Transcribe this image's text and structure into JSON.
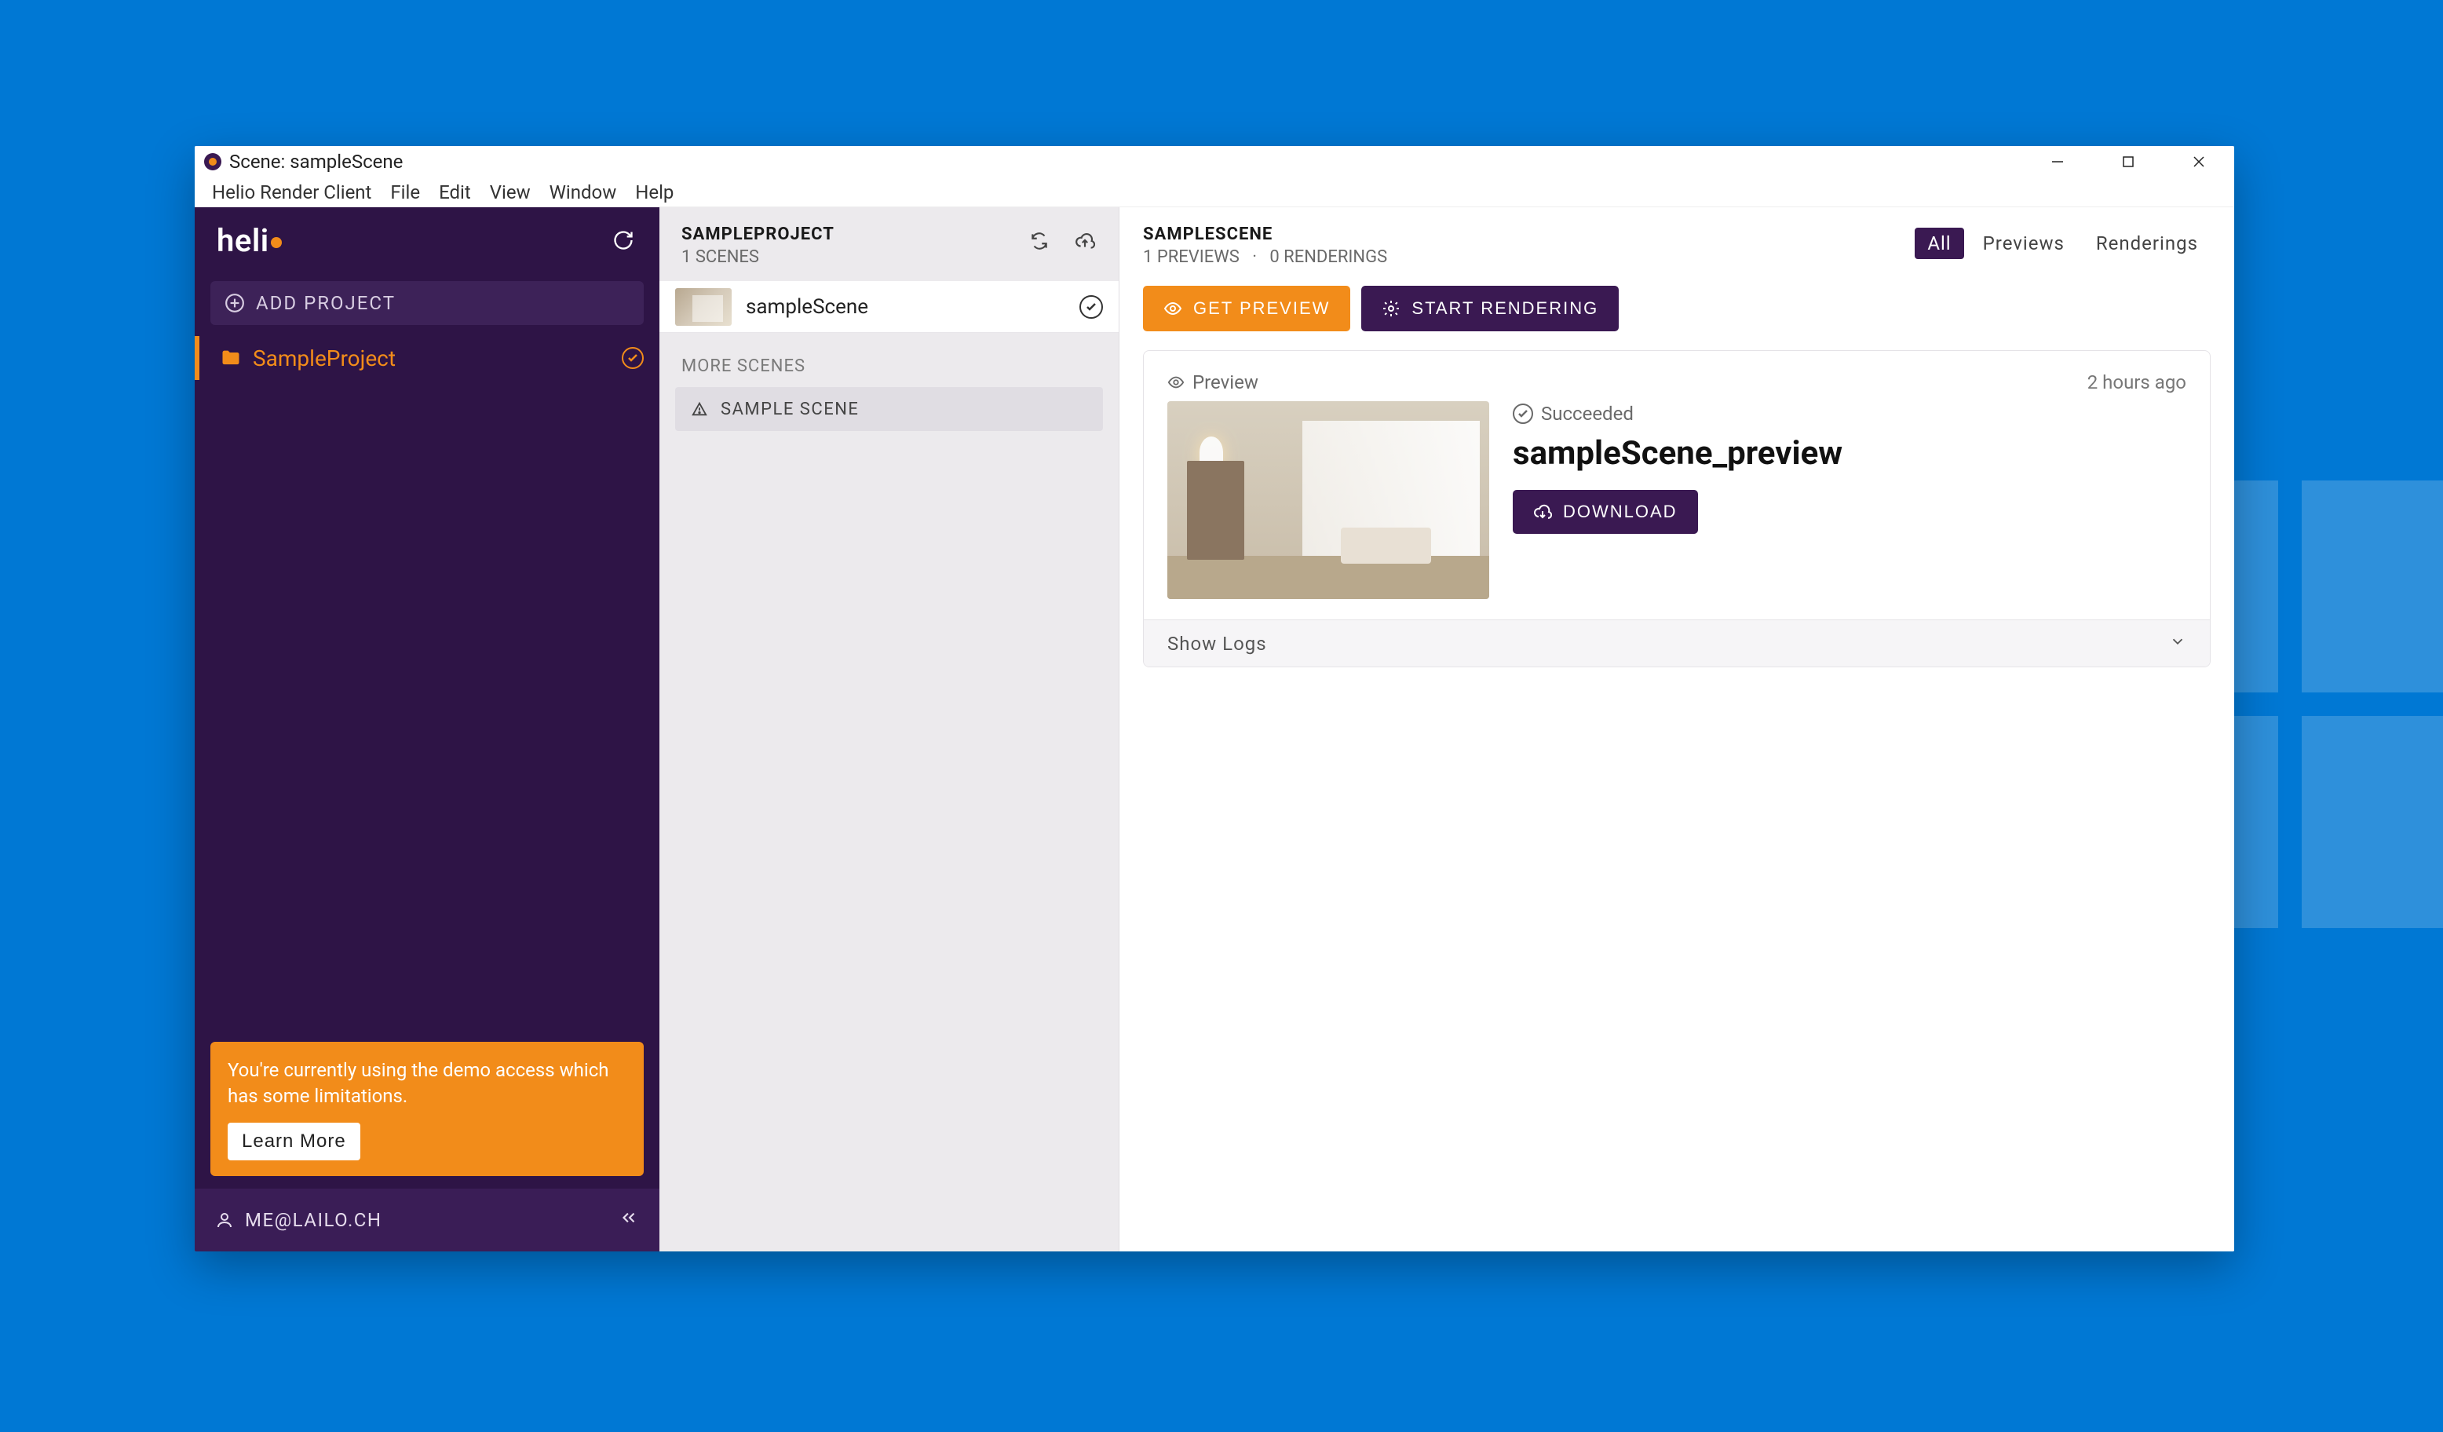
{
  "window": {
    "title": "Scene: sampleScene"
  },
  "menubar": {
    "items": [
      "Helio Render Client",
      "File",
      "Edit",
      "View",
      "Window",
      "Help"
    ]
  },
  "sidebar": {
    "logo_text": "heli",
    "add_project_label": "ADD PROJECT",
    "projects": [
      {
        "name": "SampleProject",
        "active": true
      }
    ],
    "demo_banner": {
      "text": "You're currently using the demo access which has some limitations.",
      "cta": "Learn More"
    },
    "user_email": "ME@LAILO.CH"
  },
  "scenes_panel": {
    "title": "SAMPLEPROJECT",
    "subtitle": "1 SCENES",
    "scenes": [
      {
        "name": "sampleScene"
      }
    ],
    "more_label": "MORE SCENES",
    "more_scenes": [
      {
        "name": "SAMPLE SCENE"
      }
    ]
  },
  "main_panel": {
    "title": "SAMPLESCENE",
    "subtitle_previews": "1 PREVIEWS",
    "subtitle_sep": "·",
    "subtitle_renderings": "0 RENDERINGS",
    "filters": {
      "all": "All",
      "previews": "Previews",
      "renderings": "Renderings"
    },
    "actions": {
      "get_preview": "GET PREVIEW",
      "start_rendering": "START RENDERING"
    },
    "render_card": {
      "type_label": "Preview",
      "timestamp": "2 hours ago",
      "status": "Succeeded",
      "title": "sampleScene_preview",
      "download_label": "DOWNLOAD",
      "show_logs_label": "Show Logs"
    }
  }
}
